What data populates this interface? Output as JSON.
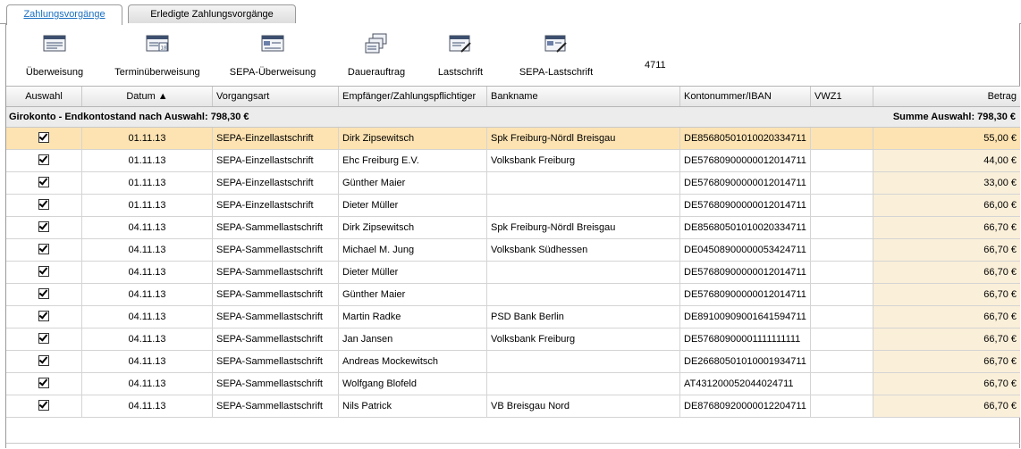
{
  "tabs": [
    {
      "label": "Zahlungsvorgänge",
      "active": true
    },
    {
      "label": "Erledigte Zahlungsvorgänge",
      "active": false
    }
  ],
  "toolbar": {
    "buttons": [
      {
        "label": "Überweisung",
        "icon": "transfer-icon"
      },
      {
        "label": "Terminüberweisung",
        "icon": "scheduled-transfer-icon"
      },
      {
        "label": "SEPA-Überweisung",
        "icon": "sepa-transfer-icon"
      },
      {
        "label": "Dauerauftrag",
        "icon": "standing-order-icon"
      },
      {
        "label": "Lastschrift",
        "icon": "direct-debit-icon"
      },
      {
        "label": "SEPA-Lastschrift",
        "icon": "sepa-direct-debit-icon"
      }
    ],
    "account_number": "4711"
  },
  "table": {
    "columns": [
      "Auswahl",
      "Datum ▲",
      "Vorgangsart",
      "Empfänger/Zahlungspflichtiger",
      "Bankname",
      "Kontonummer/IBAN",
      "VWZ1",
      "Betrag"
    ],
    "group": {
      "left": "Girokonto - Endkontostand nach Auswahl: 798,30 €",
      "right": "Summe Auswahl: 798,30 €"
    },
    "rows": [
      {
        "checked": true,
        "date": "01.11.13",
        "type": "SEPA-Einzellastschrift",
        "payee": "Dirk Zipsewitsch",
        "bank": "Spk Freiburg-Nördl Breisgau",
        "iban": "DE85680501010020334711",
        "vwz": "",
        "amount": "55,00 €",
        "selected": true
      },
      {
        "checked": true,
        "date": "01.11.13",
        "type": "SEPA-Einzellastschrift",
        "payee": "Ehc Freiburg E.V.",
        "bank": "Volksbank Freiburg",
        "iban": "DE57680900000012014711",
        "vwz": "",
        "amount": "44,00 €"
      },
      {
        "checked": true,
        "date": "01.11.13",
        "type": "SEPA-Einzellastschrift",
        "payee": "Günther Maier",
        "bank": "",
        "iban": "DE57680900000012014711",
        "vwz": "",
        "amount": "33,00 €"
      },
      {
        "checked": true,
        "date": "01.11.13",
        "type": "SEPA-Einzellastschrift",
        "payee": "Dieter Müller",
        "bank": "",
        "iban": "DE57680900000012014711",
        "vwz": "",
        "amount": "66,00 €"
      },
      {
        "checked": true,
        "date": "04.11.13",
        "type": "SEPA-Sammellastschrift",
        "payee": "Dirk Zipsewitsch",
        "bank": "Spk Freiburg-Nördl Breisgau",
        "iban": "DE85680501010020334711",
        "vwz": "",
        "amount": "66,70 €"
      },
      {
        "checked": true,
        "date": "04.11.13",
        "type": "SEPA-Sammellastschrift",
        "payee": "Michael M. Jung",
        "bank": "Volksbank Südhessen",
        "iban": "DE04508900000053424711",
        "vwz": "",
        "amount": "66,70 €"
      },
      {
        "checked": true,
        "date": "04.11.13",
        "type": "SEPA-Sammellastschrift",
        "payee": "Dieter Müller",
        "bank": "",
        "iban": "DE57680900000012014711",
        "vwz": "",
        "amount": "66,70 €"
      },
      {
        "checked": true,
        "date": "04.11.13",
        "type": "SEPA-Sammellastschrift",
        "payee": "Günther Maier",
        "bank": "",
        "iban": "DE57680900000012014711",
        "vwz": "",
        "amount": "66,70 €"
      },
      {
        "checked": true,
        "date": "04.11.13",
        "type": "SEPA-Sammellastschrift",
        "payee": "Martin Radke",
        "bank": "PSD Bank Berlin",
        "iban": "DE89100909001641594711",
        "vwz": "",
        "amount": "66,70 €"
      },
      {
        "checked": true,
        "date": "04.11.13",
        "type": "SEPA-Sammellastschrift",
        "payee": "Jan Jansen",
        "bank": "Volksbank Freiburg",
        "iban": "DE57680900001111111111",
        "vwz": "",
        "amount": "66,70 €"
      },
      {
        "checked": true,
        "date": "04.11.13",
        "type": "SEPA-Sammellastschrift",
        "payee": "Andreas Mockewitsch",
        "bank": "",
        "iban": "DE26680501010001934711",
        "vwz": "",
        "amount": "66,70 €"
      },
      {
        "checked": true,
        "date": "04.11.13",
        "type": "SEPA-Sammellastschrift",
        "payee": "Wolfgang Blofeld",
        "bank": "",
        "iban": "AT431200052044024711",
        "vwz": "",
        "amount": "66,70 €"
      },
      {
        "checked": true,
        "date": "04.11.13",
        "type": "SEPA-Sammellastschrift",
        "payee": "Nils Patrick",
        "bank": "VB Breisgau Nord",
        "iban": "DE87680920000012204711",
        "vwz": "",
        "amount": "66,70 €"
      }
    ]
  }
}
